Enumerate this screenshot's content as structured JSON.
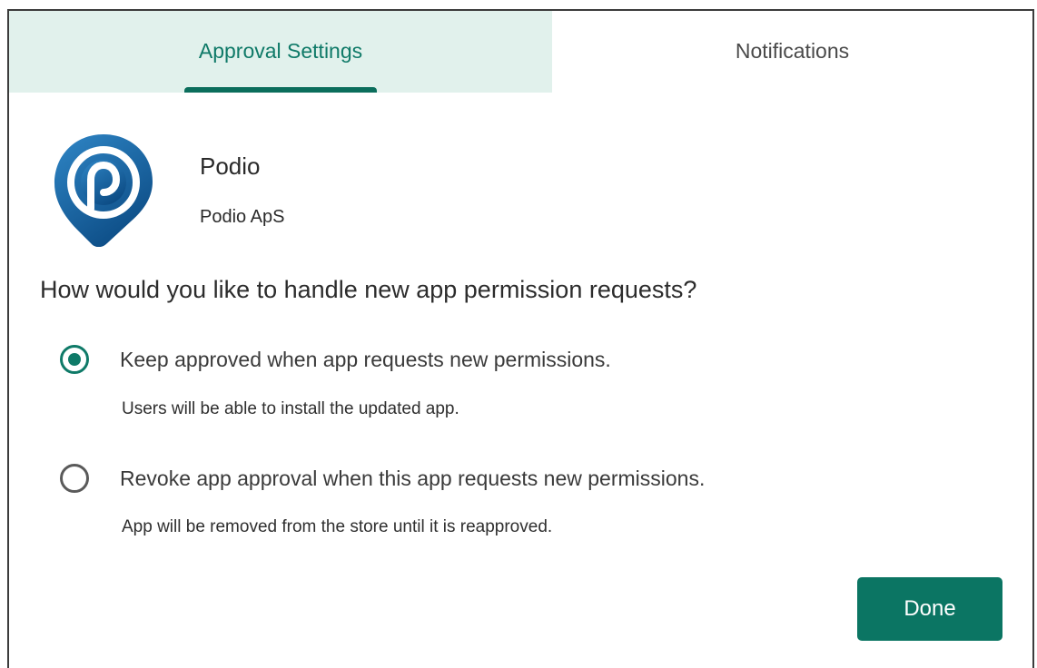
{
  "tabs": [
    {
      "label": "Approval Settings",
      "active": true
    },
    {
      "label": "Notifications",
      "active": false
    }
  ],
  "app": {
    "name": "Podio",
    "publisher": "Podio ApS",
    "icon": "podio-logo-icon"
  },
  "question": "How would you like to handle new app permission requests?",
  "options": [
    {
      "label": "Keep approved when app requests new permissions.",
      "description": "Users will be able to install the updated app.",
      "selected": true
    },
    {
      "label": "Revoke app approval when this app requests new permissions.",
      "description": "App will be removed from the store until it is reapproved.",
      "selected": false
    }
  ],
  "actions": {
    "done_label": "Done"
  },
  "colors": {
    "accent": "#0f7a68",
    "button": "#0b7563",
    "active_tab_bg": "#e1f1ec"
  }
}
